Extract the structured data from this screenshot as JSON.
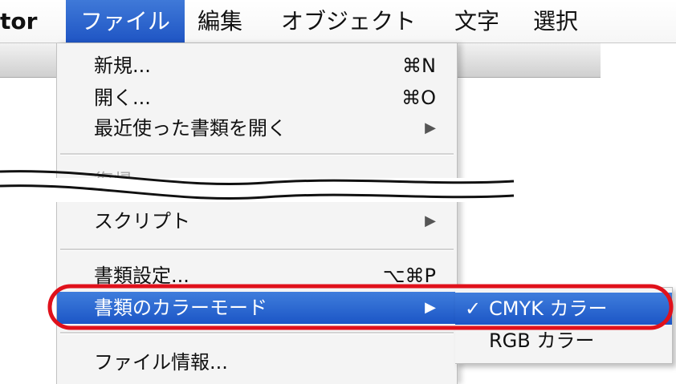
{
  "menubar": {
    "app_fragment": "tor",
    "items": [
      "ファイル",
      "編集",
      "オブジェクト",
      "文字",
      "選択"
    ]
  },
  "file_menu": {
    "items": [
      {
        "label": "新規...",
        "shortcut": "⌘N"
      },
      {
        "label": "開く...",
        "shortcut": "⌘O"
      },
      {
        "label": "最近使った書類を開く",
        "submenu": "▶"
      },
      {
        "label": "復帰",
        "disabled": true
      },
      {
        "label": "スクリプト",
        "submenu": "▶"
      },
      {
        "label": "書類設定...",
        "shortcut": "⌥⌘P"
      },
      {
        "label": "書類のカラーモード",
        "submenu": "▶",
        "highlighted": true
      },
      {
        "label": "ファイル情報..."
      }
    ]
  },
  "color_mode_submenu": {
    "items": [
      {
        "label": "CMYK カラー",
        "check": "✓",
        "selected": true
      },
      {
        "label": "RGB カラー"
      }
    ]
  },
  "colors": {
    "highlight": "#2a64d0",
    "annotation_red": "#e0111b"
  }
}
